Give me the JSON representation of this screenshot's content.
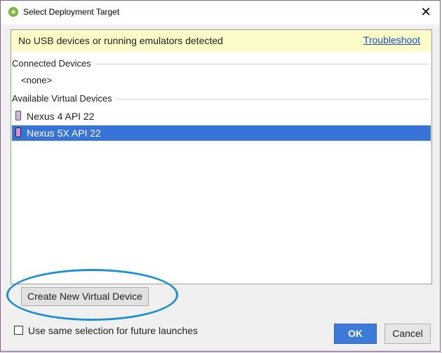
{
  "window": {
    "title": "Select Deployment Target",
    "close_icon": "close-icon"
  },
  "notice": {
    "text": "No USB devices or running emulators detected",
    "link": "Troubleshoot"
  },
  "connected_devices": {
    "header": "Connected Devices",
    "none_label": "<none>"
  },
  "virtual_devices": {
    "header": "Available Virtual Devices",
    "items": [
      {
        "label": "Nexus 4 API 22",
        "selected": false,
        "icon": "phone-icon"
      },
      {
        "label": "Nexus 5X API 22",
        "selected": true,
        "icon": "phone-icon"
      }
    ]
  },
  "actions": {
    "create_label": "Create New Virtual Device",
    "same_selection_label": "Use same selection for future launches",
    "same_selection_checked": false,
    "ok_label": "OK",
    "cancel_label": "Cancel"
  },
  "colors": {
    "selection": "#3874d8",
    "notice_bg": "#fcfcc8",
    "annotation": "#1f8fd0",
    "ok_button": "#3d7bd9"
  }
}
